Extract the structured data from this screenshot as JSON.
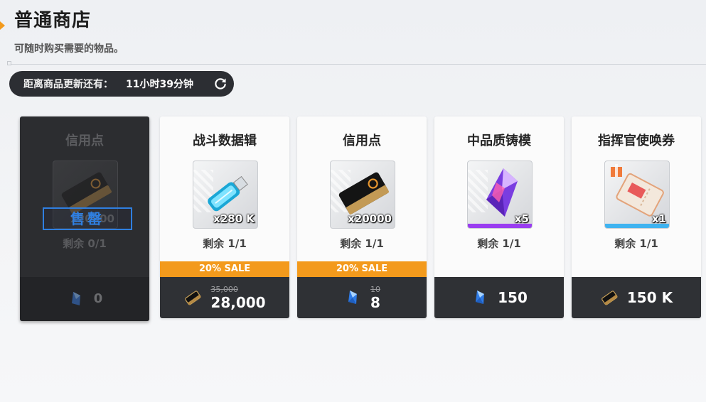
{
  "header": {
    "title": "普通商店",
    "subtitle": "可随时购买需要的物品。"
  },
  "timer": {
    "label": "距离商品更新还有：",
    "value": "11小时39分钟",
    "refresh_icon": "refresh-icon"
  },
  "colors": {
    "accent": "#f39a1c",
    "sold_border": "#2f7fe0",
    "price_bar": "#2f3135"
  },
  "items": [
    {
      "name": "信用点",
      "icon": "credit-card-icon",
      "quantity": "x20000",
      "remaining": "剩余 0/1",
      "sale": "",
      "price_old": "",
      "price": "0",
      "currency_icon": "gem-icon",
      "sold_label": "售罄"
    },
    {
      "name": "战斗数据辑",
      "icon": "usb-drive-icon",
      "quantity": "x280 K",
      "remaining": "剩余 1/1",
      "sale": "20% SALE",
      "price_old": "35,000",
      "price": "28,000",
      "currency_icon": "credit-card-icon"
    },
    {
      "name": "信用点",
      "icon": "credit-card-icon",
      "quantity": "x20000",
      "remaining": "剩余 1/1",
      "sale": "20% SALE",
      "price_old": "10",
      "price": "8",
      "currency_icon": "gem-icon"
    },
    {
      "name": "中品质铸模",
      "icon": "crystal-mold-icon",
      "quantity": "x5",
      "remaining": "剩余 1/1",
      "sale": "",
      "price_old": "",
      "price": "150",
      "currency_icon": "gem-icon"
    },
    {
      "name": "指挥官使唤券",
      "icon": "ticket-icon",
      "quantity": "x1",
      "remaining": "剩余 1/1",
      "sale": "",
      "price_old": "",
      "price": "150 K",
      "currency_icon": "credit-card-icon"
    }
  ]
}
